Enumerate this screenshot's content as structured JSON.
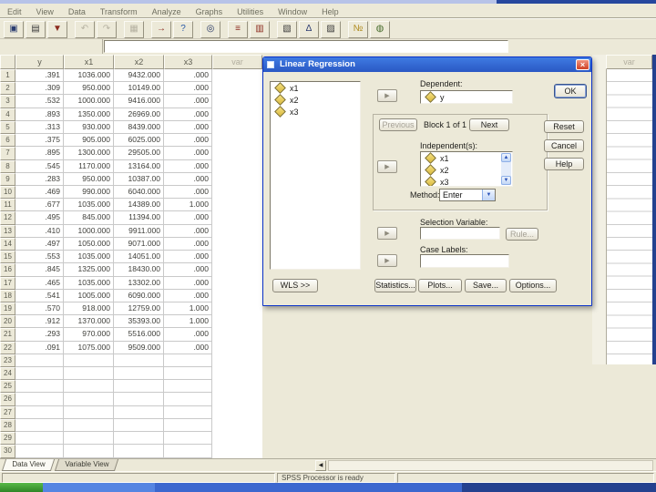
{
  "menu": {
    "items": [
      "Edit",
      "View",
      "Data",
      "Transform",
      "Analyze",
      "Graphs",
      "Utilities",
      "Window",
      "Help"
    ]
  },
  "toolbar": {
    "icons": [
      {
        "name": "save-icon",
        "glyph": "▣",
        "color": "#2c3e70",
        "disabled": false,
        "gap_after": false
      },
      {
        "name": "print-icon",
        "glyph": "▤",
        "color": "#3a3a3a",
        "disabled": false,
        "gap_after": false
      },
      {
        "name": "dialog-recall-icon",
        "glyph": "▼",
        "color": "#8b2a1e",
        "disabled": false,
        "gap_after": true
      },
      {
        "name": "undo-icon",
        "glyph": "↶",
        "color": "#b6b2a2",
        "disabled": true,
        "gap_after": false
      },
      {
        "name": "redo-icon",
        "glyph": "↷",
        "color": "#b6b2a2",
        "disabled": true,
        "gap_after": true
      },
      {
        "name": "goto-chart-icon",
        "glyph": "▦",
        "color": "#b6b2a2",
        "disabled": true,
        "gap_after": true
      },
      {
        "name": "goto-case-icon",
        "glyph": "→",
        "color": "#8b2a1e",
        "disabled": false,
        "gap_after": false
      },
      {
        "name": "variable-info-icon",
        "glyph": "?",
        "color": "#2a5aa8",
        "disabled": false,
        "gap_after": true
      },
      {
        "name": "find-icon",
        "glyph": "◎",
        "color": "#203060",
        "disabled": false,
        "gap_after": true
      },
      {
        "name": "insert-case-icon",
        "glyph": "≡",
        "color": "#8b2a1e",
        "disabled": false,
        "gap_after": false
      },
      {
        "name": "insert-variable-icon",
        "glyph": "▥",
        "color": "#8b2a1e",
        "disabled": false,
        "gap_after": true
      },
      {
        "name": "split-file-icon",
        "glyph": "▧",
        "color": "#3a3a3a",
        "disabled": false,
        "gap_after": false
      },
      {
        "name": "weight-cases-icon",
        "glyph": "Δ",
        "color": "#2a3a70",
        "disabled": false,
        "gap_after": false
      },
      {
        "name": "select-cases-icon",
        "glyph": "▨",
        "color": "#3a3a3a",
        "disabled": false,
        "gap_after": true
      },
      {
        "name": "value-labels-icon",
        "glyph": "№",
        "color": "#b08c20",
        "disabled": false,
        "gap_after": false
      },
      {
        "name": "use-sets-icon",
        "glyph": "◍",
        "color": "#446a2a",
        "disabled": false,
        "gap_after": false
      }
    ]
  },
  "cell_editor": {
    "value": ""
  },
  "grid": {
    "columns": [
      "y",
      "x1",
      "x2",
      "x3"
    ],
    "undefined_column_label": "var",
    "total_rows": 30,
    "rows": [
      [
        ".391",
        "1036.000",
        "9432.000",
        ".000"
      ],
      [
        ".309",
        "950.000",
        "10149.00",
        ".000"
      ],
      [
        ".532",
        "1000.000",
        "9416.000",
        ".000"
      ],
      [
        ".893",
        "1350.000",
        "26969.00",
        ".000"
      ],
      [
        ".313",
        "930.000",
        "8439.000",
        ".000"
      ],
      [
        ".375",
        "905.000",
        "6025.000",
        ".000"
      ],
      [
        ".895",
        "1300.000",
        "29505.00",
        ".000"
      ],
      [
        ".545",
        "1170.000",
        "13164.00",
        ".000"
      ],
      [
        ".283",
        "950.000",
        "10387.00",
        ".000"
      ],
      [
        ".469",
        "990.000",
        "6040.000",
        ".000"
      ],
      [
        ".677",
        "1035.000",
        "14389.00",
        "1.000"
      ],
      [
        ".495",
        "845.000",
        "11394.00",
        ".000"
      ],
      [
        ".410",
        "1000.000",
        "9911.000",
        ".000"
      ],
      [
        ".497",
        "1050.000",
        "9071.000",
        ".000"
      ],
      [
        ".553",
        "1035.000",
        "14051.00",
        ".000"
      ],
      [
        ".845",
        "1325.000",
        "18430.00",
        ".000"
      ],
      [
        ".465",
        "1035.000",
        "13302.00",
        ".000"
      ],
      [
        ".541",
        "1005.000",
        "6090.000",
        ".000"
      ],
      [
        ".570",
        "918.000",
        "12759.00",
        "1.000"
      ],
      [
        ".912",
        "1370.000",
        "35393.00",
        "1.000"
      ],
      [
        ".293",
        "970.000",
        "5516.000",
        ".000"
      ],
      [
        ".091",
        "1075.000",
        "9509.000",
        ".000"
      ]
    ]
  },
  "background_window": {
    "column_label": "var"
  },
  "dialog": {
    "title": "Linear Regression",
    "source_variables": [
      "x1",
      "x2",
      "x3"
    ],
    "dependent_label": "Dependent:",
    "dependent_value": "y",
    "previous_label": "Previous",
    "block_label": "Block 1 of 1",
    "next_label": "Next",
    "independent_label": "Independent(s):",
    "independent_variables": [
      "x1",
      "x2",
      "x3"
    ],
    "method_label": "Method:",
    "method_value": "Enter",
    "selection_label": "Selection Variable:",
    "selection_value": "",
    "rule_label": "Rule...",
    "case_labels_label": "Case Labels:",
    "case_labels_value": "",
    "wls_label": "WLS >>",
    "statistics_label": "Statistics...",
    "plots_label": "Plots...",
    "save_label": "Save...",
    "options_label": "Options...",
    "ok_label": "OK",
    "reset_label": "Reset",
    "cancel_label": "Cancel",
    "help_label": "Help"
  },
  "sheet_tabs": {
    "data_view": "Data View",
    "variable_view": "Variable View",
    "active": "Data View"
  },
  "status_bar": {
    "text": "SPSS Processor is ready"
  },
  "glyphs": {
    "close": "×",
    "right_arrow": "▶",
    "up": "▲",
    "down": "▼",
    "left": "◀"
  },
  "colors": {
    "window_beige": "#ece9d8",
    "titlebar_blue": "#2a58c4",
    "dialog_border": "#0a31c8",
    "taskbar_green": "#44a238",
    "taskbar_blue_light": "#5585e2",
    "taskbar_blue": "#3c68cf",
    "taskbar_navy": "#24418f"
  }
}
